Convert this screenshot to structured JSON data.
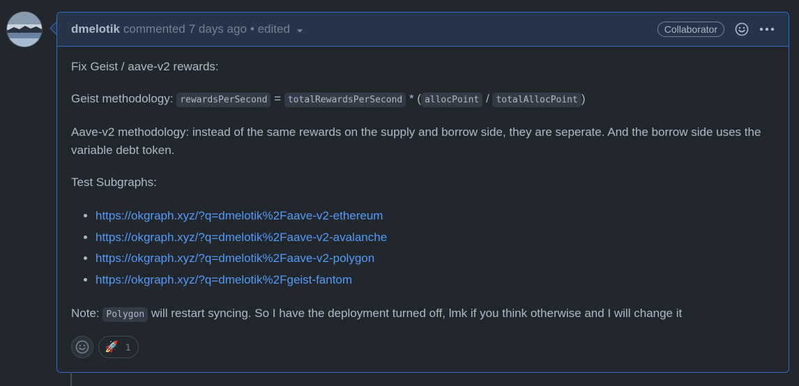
{
  "header": {
    "author": "dmelotik",
    "commented": "commented",
    "time": "7 days ago",
    "edited": "• edited",
    "badge": "Collaborator"
  },
  "body": {
    "p1": "Fix Geist / aave-v2 rewards:",
    "geist_prefix": "Geist methodology:",
    "code_rewards": "rewardsPerSecond",
    "eq": "=",
    "code_total": "totalRewardsPerSecond",
    "mult": "* (",
    "code_alloc": "allocPoint",
    "div": "/",
    "code_total_alloc": "totalAllocPoint",
    "close": ")",
    "aave": "Aave-v2 methodology: instead of the same rewards on the supply and borrow side, they are seperate. And the borrow side uses the variable debt token.",
    "test_heading": "Test Subgraphs:",
    "links": [
      "https://okgraph.xyz/?q=dmelotik%2Faave-v2-ethereum",
      "https://okgraph.xyz/?q=dmelotik%2Faave-v2-avalanche",
      "https://okgraph.xyz/?q=dmelotik%2Faave-v2-polygon",
      "https://okgraph.xyz/?q=dmelotik%2Fgeist-fantom"
    ],
    "note_prefix": "Note:",
    "code_polygon": "Polygon",
    "note_suffix": "will restart syncing. So I have the deployment turned off, lmk if you think otherwise and I will change it"
  },
  "reactions": {
    "rocket_emoji": "🚀",
    "rocket_count": "1"
  },
  "icons": {
    "add_reaction": "smiley-icon",
    "more": "kebab-horizontal-icon"
  },
  "colors": {
    "accent": "#316dca",
    "link": "#539bf5"
  }
}
